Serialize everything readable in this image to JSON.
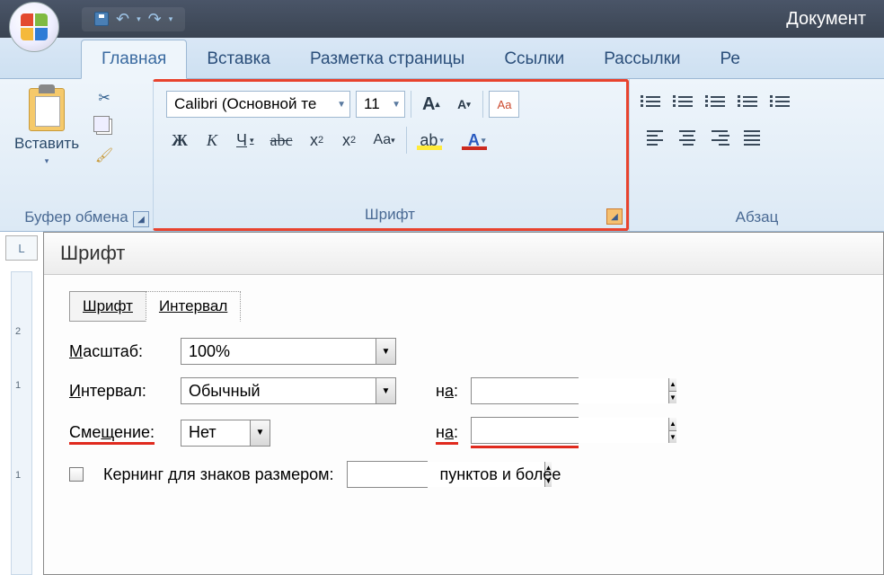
{
  "titlebar": {
    "doc_title": "Документ"
  },
  "tabs": {
    "home": "Главная",
    "insert": "Вставка",
    "layout": "Разметка страницы",
    "refs": "Ссылки",
    "mail": "Рассылки",
    "review": "Ре"
  },
  "ribbon": {
    "clipboard": {
      "paste": "Вставить",
      "group": "Буфер обмена"
    },
    "font": {
      "name": "Calibri (Основной те",
      "size": "11",
      "group": "Шрифт",
      "bold": "Ж",
      "italic": "К",
      "underline": "Ч",
      "strike": "abc",
      "sub": "x",
      "sup": "x",
      "case": "Aa",
      "grow": "A",
      "shrink": "A",
      "clear": "Aa",
      "highlight": "ab",
      "color": "A"
    },
    "paragraph": {
      "group": "Абзац"
    }
  },
  "dialog": {
    "title": "Шрифт",
    "tab_font": "Шрифт",
    "tab_interval": "Интервал",
    "scale_label": "Масштаб:",
    "scale_value": "100%",
    "spacing_label": "Интервал:",
    "spacing_value": "Обычный",
    "position_label": "Смещение:",
    "position_value": "Нет",
    "by_label": "на:",
    "kerning_label": "Кернинг для знаков размером:",
    "kerning_suffix": "пунктов и более"
  }
}
